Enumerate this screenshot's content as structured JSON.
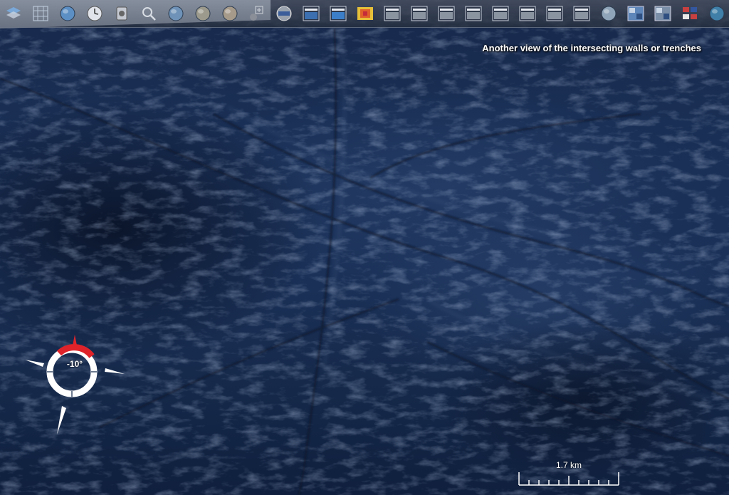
{
  "toolbar": {
    "items": [
      {
        "name": "layer-manager-icon",
        "color": "#7aa8d8"
      },
      {
        "name": "graticule-icon",
        "color": "#b9c6d6"
      },
      {
        "name": "globe-grid-icon",
        "color": "#5c8fc4"
      },
      {
        "name": "clock-icon",
        "color": "#e0e4ea"
      },
      {
        "name": "camera-icon",
        "color": "#c4c8d0"
      },
      {
        "name": "search-icon",
        "color": "#d8dde4"
      },
      {
        "name": "earth-icon",
        "color": "#6f93b8"
      },
      {
        "name": "moon-icon",
        "color": "#9c9a8c"
      },
      {
        "name": "mars-icon",
        "color": "#a69a8a"
      },
      {
        "name": "add-placemark-icon",
        "color": "#d0d4da"
      },
      {
        "name": "compass-rose-icon",
        "color": "#c8c8c8"
      },
      {
        "name": "image-layer-icon",
        "color": "#3b6fb0"
      },
      {
        "name": "mmis-layer-icon",
        "color": "#3c7fc8"
      },
      {
        "name": "heatmap-layer-icon",
        "color": "#e89a3a"
      },
      {
        "name": "map-layer-1-icon",
        "color": "#8a93a0"
      },
      {
        "name": "map-layer-2-icon",
        "color": "#8a93a0"
      },
      {
        "name": "map-layer-3-icon",
        "color": "#8a93a0"
      },
      {
        "name": "map-layer-4-icon",
        "color": "#8a93a0"
      },
      {
        "name": "map-layer-5-icon",
        "color": "#8a93a0"
      },
      {
        "name": "map-layer-6-icon",
        "color": "#8a93a0"
      },
      {
        "name": "map-layer-7-icon",
        "color": "#8a93a0"
      },
      {
        "name": "map-layer-8-icon",
        "color": "#8a93a0"
      },
      {
        "name": "jupiter-moon-icon",
        "color": "#8fa4b8"
      },
      {
        "name": "satellite-image-icon",
        "color": "#5f86b8"
      },
      {
        "name": "photo-collage-icon",
        "color": "#7a8ea8"
      },
      {
        "name": "flags-icon",
        "color": "#c84040"
      },
      {
        "name": "ocean-map-icon",
        "color": "#3f7fa8"
      },
      {
        "name": "usa-map-icon",
        "color": "#b7c49a"
      },
      {
        "name": "settings-grid-icon",
        "color": "#a0a8b8"
      }
    ]
  },
  "caption": "Another view of the intersecting walls or trenches",
  "compass": {
    "tilt_label": "-10°",
    "ring_color": "#ffffff",
    "north_color": "#e0232a"
  },
  "scale": {
    "label": "1.7 km"
  }
}
